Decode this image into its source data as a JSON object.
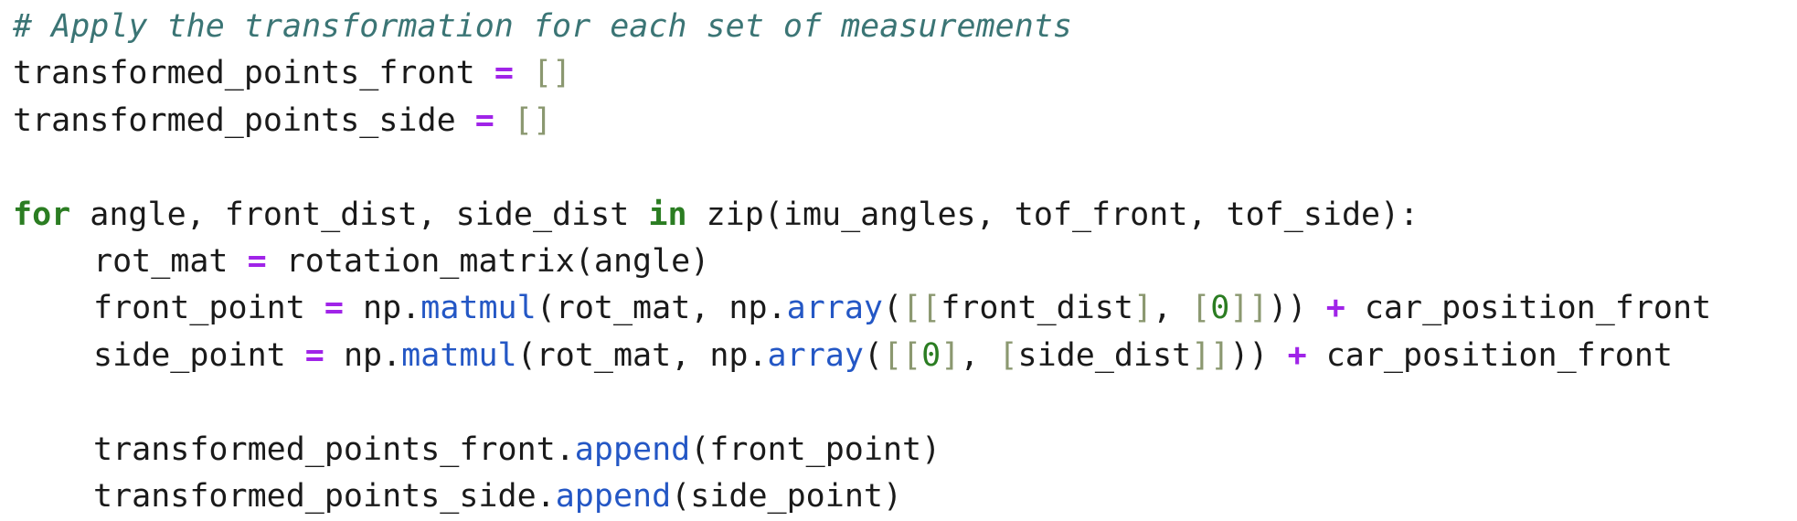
{
  "code": {
    "l1": {
      "comment": "# Apply the transformation for each set of measurements"
    },
    "l2": {
      "a": "transformed_points_front",
      "b": " ",
      "op": "=",
      "c": " ",
      "br": "[]"
    },
    "l3": {
      "a": "transformed_points_side",
      "b": " ",
      "op": "=",
      "c": " ",
      "br": "[]"
    },
    "l5": {
      "kw1": "for",
      "a": " angle, front_dist, side_dist ",
      "kw2": "in",
      "b": " zip(imu_angles, tof_front, tof_side):"
    },
    "l6": {
      "a": "rot_mat ",
      "op": "=",
      "b": " rotation_matrix(angle)"
    },
    "l7": {
      "a": "front_point ",
      "op": "=",
      "b": " np.",
      "fn1": "matmul",
      "c": "(rot_mat, np.",
      "fn2": "array",
      "d": "(",
      "br1": "[[",
      "e": "front_dist",
      "br2": "]",
      "f": ", ",
      "br3": "[",
      "num": "0",
      "br4": "]]",
      "g": ")) ",
      "op2": "+",
      "h": " car_position_front"
    },
    "l8": {
      "a": "side_point ",
      "op": "=",
      "b": " np.",
      "fn1": "matmul",
      "c": "(rot_mat, np.",
      "fn2": "array",
      "d": "(",
      "br1": "[[",
      "num": "0",
      "br2": "]",
      "e": ", ",
      "br3": "[",
      "f": "side_dist",
      "br4": "]]",
      "g": ")) ",
      "op2": "+",
      "h": " car_position_front"
    },
    "l10": {
      "a": "transformed_points_front.",
      "fn": "append",
      "b": "(front_point)"
    },
    "l11": {
      "a": "transformed_points_side.",
      "fn": "append",
      "b": "(side_point)"
    }
  }
}
